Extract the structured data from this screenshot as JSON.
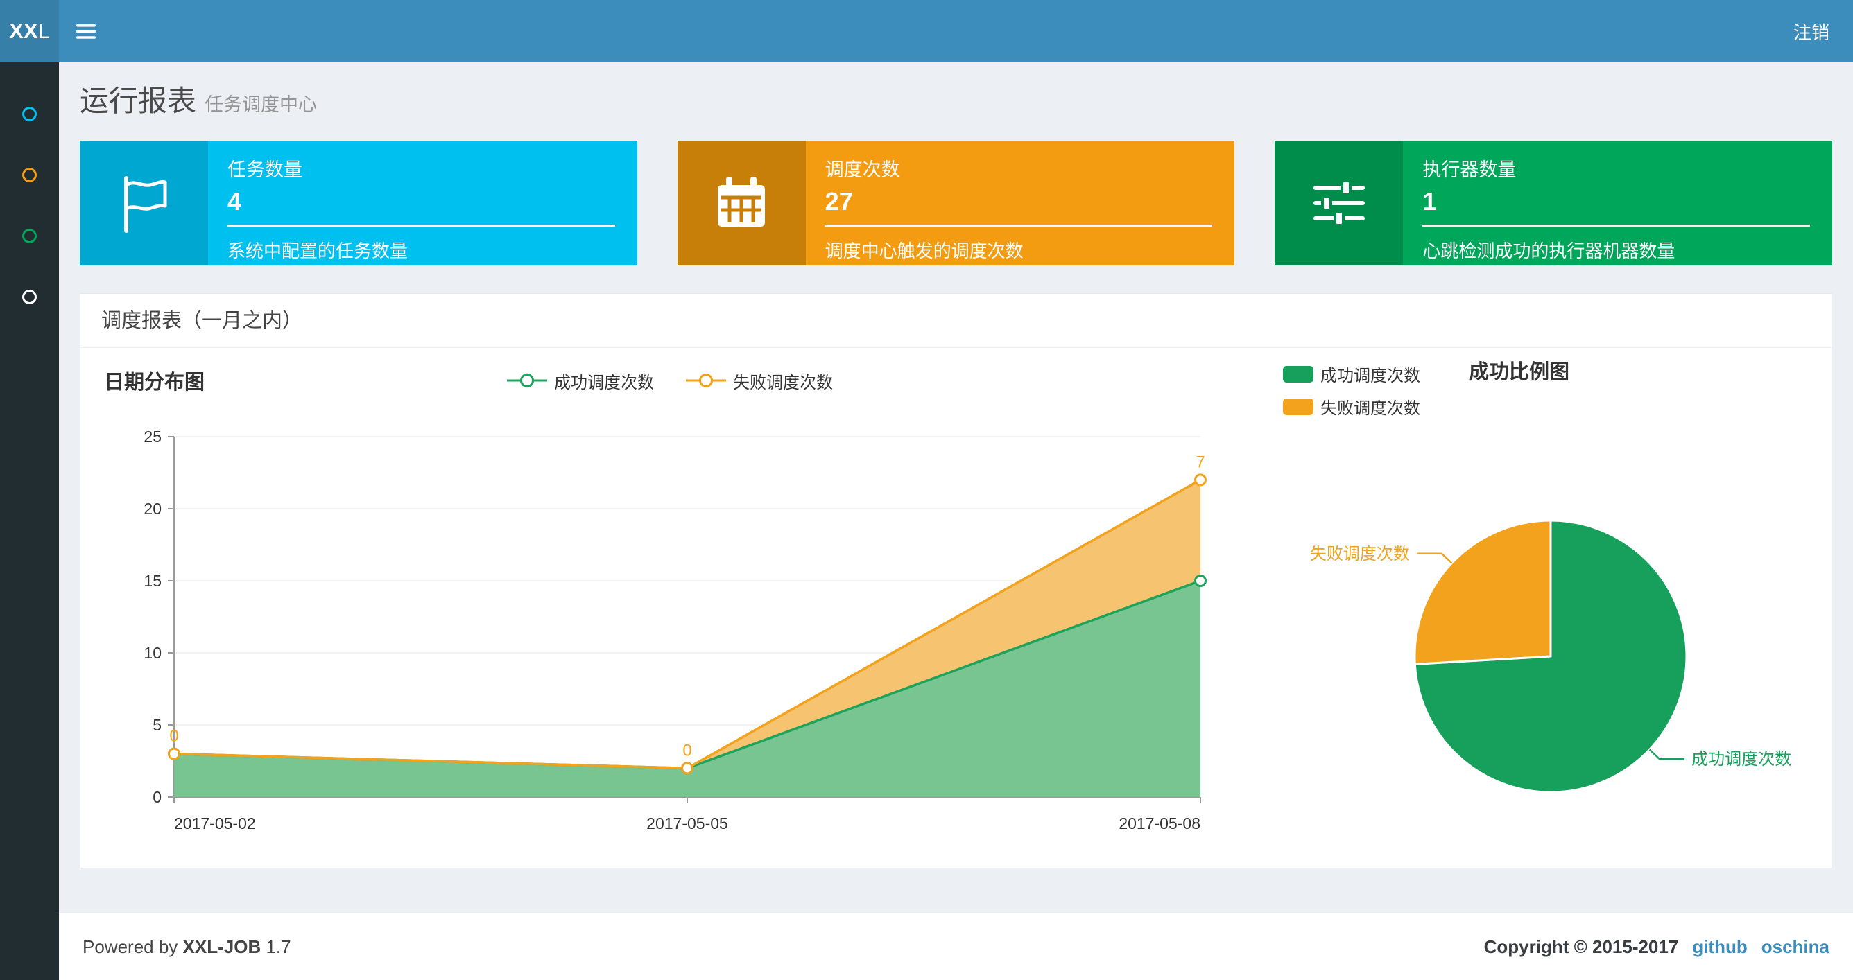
{
  "navbar": {
    "logo_bold": "XX",
    "logo_rest": "L",
    "logout": "注销"
  },
  "sidebar": {
    "items": [
      {
        "icon": "circle-o-icon",
        "color": "#00c0ef"
      },
      {
        "icon": "circle-o-icon",
        "color": "#f39c12"
      },
      {
        "icon": "circle-o-icon",
        "color": "#00a65a"
      },
      {
        "icon": "circle-o-icon",
        "color": "#ffffff"
      }
    ]
  },
  "page_header": {
    "title": "运行报表",
    "subtitle": "任务调度中心"
  },
  "info_boxes": [
    {
      "title": "任务数量",
      "value": "4",
      "desc": "系统中配置的任务数量",
      "color": "#00c0ef",
      "icon_bg": "#00a7d0",
      "icon": "flag-icon"
    },
    {
      "title": "调度次数",
      "value": "27",
      "desc": "调度中心触发的调度次数",
      "color": "#f39c12",
      "icon_bg": "#c87f0a",
      "icon": "calendar-icon"
    },
    {
      "title": "执行器数量",
      "value": "1",
      "desc": "心跳检测成功的执行器机器数量",
      "color": "#00a65a",
      "icon_bg": "#008d4c",
      "icon": "sliders-icon"
    }
  ],
  "panel": {
    "title": "调度报表（一月之内）"
  },
  "chart_data": [
    {
      "type": "area",
      "title": "日期分布图",
      "x": [
        "2017-05-02",
        "2017-05-05",
        "2017-05-08"
      ],
      "series": [
        {
          "name": "成功调度次数",
          "values": [
            3,
            2,
            15
          ],
          "color": "#1fa35c",
          "fill": "#71c28c"
        },
        {
          "name": "失败调度次数",
          "values": [
            0,
            0,
            7
          ],
          "color": "#f2a21c",
          "fill": "#f6c169"
        }
      ],
      "stacked": true,
      "labels_series_index": 1,
      "ylim": [
        0,
        25
      ],
      "yticks": [
        0,
        5,
        10,
        15,
        20,
        25
      ],
      "grid": true,
      "legend_position": "top-center"
    },
    {
      "type": "pie",
      "title": "成功比例图",
      "slices": [
        {
          "name": "成功调度次数",
          "value": 20,
          "color": "#17a05c"
        },
        {
          "name": "失败调度次数",
          "value": 7,
          "color": "#f2a21c"
        }
      ],
      "legend_position": "top-left",
      "start_angle": 90,
      "clockwise": true
    }
  ],
  "footer": {
    "powered_prefix": "Powered by",
    "product": "XXL-JOB",
    "version": "1.7",
    "copyright": "Copyright © 2015-2017",
    "links": [
      "github",
      "oschina"
    ]
  }
}
